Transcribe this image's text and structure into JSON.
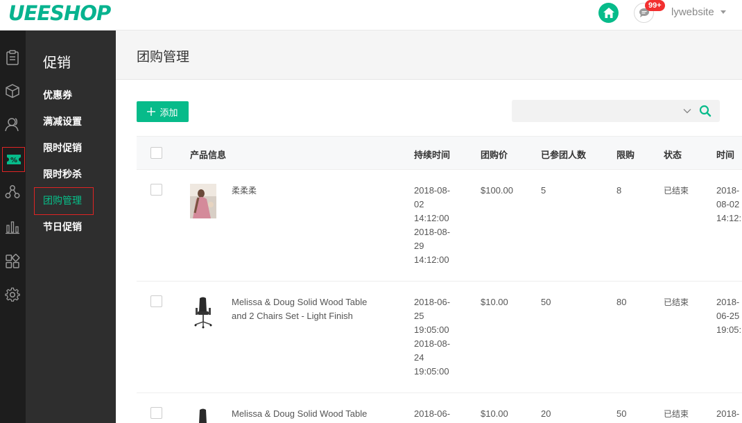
{
  "header": {
    "logo": "UEESHOP",
    "badge_count": "99+",
    "username": "lywebsite"
  },
  "colors": {
    "accent": "#07bb8a",
    "alert": "#e02424",
    "sidebar": "#2e2e2e",
    "rail": "#1d1d1d"
  },
  "rail_icons": [
    "orders-icon",
    "products-icon",
    "users-icon",
    "promotion-icon",
    "share-icon",
    "stats-icon",
    "apps-icon",
    "settings-icon"
  ],
  "subnav": {
    "title": "促销",
    "items": [
      {
        "label": "优惠券"
      },
      {
        "label": "满减设置"
      },
      {
        "label": "限时促销"
      },
      {
        "label": "限时秒杀"
      },
      {
        "label": "团购管理"
      },
      {
        "label": "节日促销"
      }
    ]
  },
  "page": {
    "title": "团购管理",
    "add_label": "添加",
    "search_placeholder": ""
  },
  "table": {
    "columns": [
      "产品信息",
      "持续时间",
      "团购价",
      "已参团人数",
      "限购",
      "状态",
      "时间"
    ],
    "rows": [
      {
        "name": "柔柔柔",
        "duration_lines": [
          "2018-08-",
          "02",
          "14:12:00",
          "2018-08-",
          "29",
          "14:12:00"
        ],
        "price": "$100.00",
        "joined": "5",
        "limit": "8",
        "status": "已结束",
        "time_lines": [
          "2018-",
          "08-02",
          "14:12:"
        ]
      },
      {
        "name": "Melissa & Doug Solid Wood Table and 2 Chairs Set - Light Finish",
        "duration_lines": [
          "2018-06-",
          "25",
          "19:05:00",
          "2018-08-",
          "24",
          "19:05:00"
        ],
        "price": "$10.00",
        "joined": "50",
        "limit": "80",
        "status": "已结束",
        "time_lines": [
          "2018-",
          "06-25",
          "19:05:"
        ]
      },
      {
        "name": "Melissa & Doug Solid Wood Table",
        "duration_lines": [
          "2018-06-"
        ],
        "price": "$10.00",
        "joined": "20",
        "limit": "50",
        "status": "已结束",
        "time_lines": [
          "2018-"
        ]
      }
    ]
  }
}
